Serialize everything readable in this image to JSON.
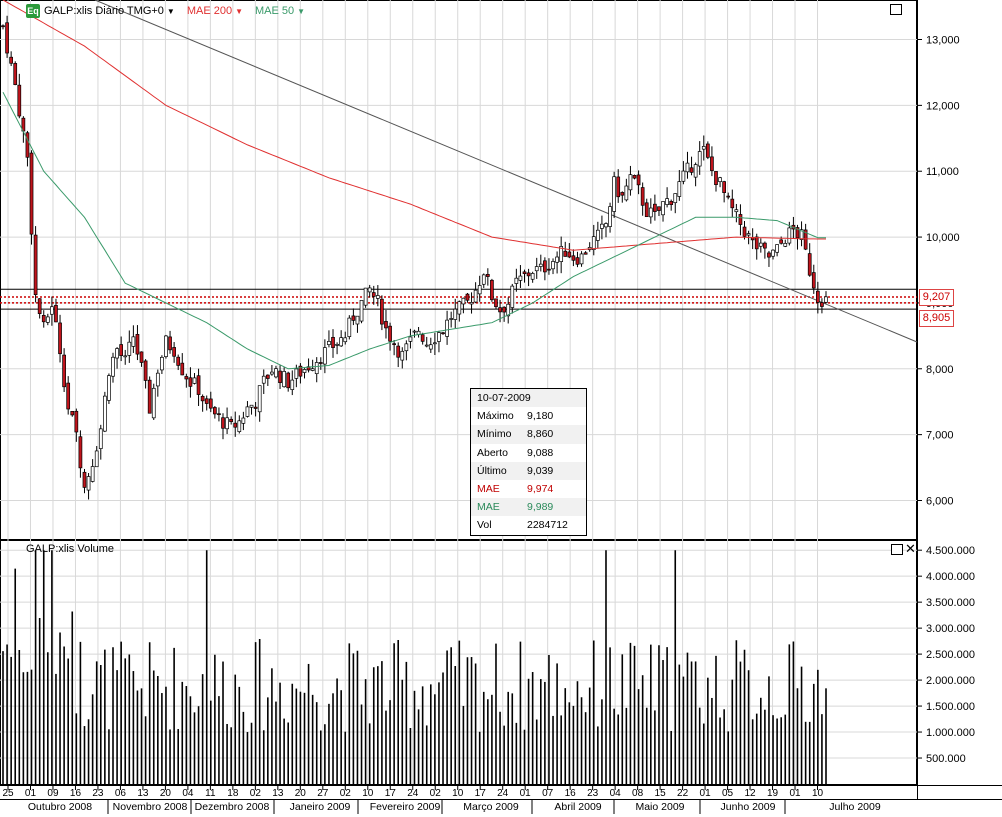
{
  "legend": {
    "badge": "Eq",
    "symbol": "GALP:xlis Diário TMG+0",
    "mae200": "MAE 200",
    "mae50": "MAE 50",
    "mae200_color": "#e03030",
    "mae50_color": "#3a9a6a"
  },
  "volume_panel": {
    "title": "GALP:xlis Volume"
  },
  "icons": {
    "maximize": "maximize-icon",
    "close": "close-icon"
  },
  "infobox": {
    "date": "10-07-2009",
    "rows": [
      {
        "label": "Máximo",
        "value": "9,180"
      },
      {
        "label": "Mínimo",
        "value": "8,860"
      },
      {
        "label": "Aberto",
        "value": "9,088"
      },
      {
        "label": "Último",
        "value": "9,039"
      },
      {
        "label": "MAE",
        "value": "9,974",
        "color": "#c00000"
      },
      {
        "label": "MAE",
        "value": "9,989",
        "color": "#2a8a5a"
      },
      {
        "label": "Vol",
        "value": "2284712"
      }
    ]
  },
  "price_tags": [
    "9,207",
    "8,905"
  ],
  "chart_data": {
    "type": "candlestick",
    "price_axis": {
      "ylim": [
        5.4,
        13.6
      ],
      "ticks": [
        13,
        12,
        11,
        10,
        9,
        8,
        7,
        6
      ],
      "tick_labels": [
        "13,000",
        "12,000",
        "11,000",
        "10,000",
        "9,000",
        "8,000",
        "7,000",
        "6,000"
      ]
    },
    "volume_axis": {
      "ylim": [
        0,
        4600000
      ],
      "ticks": [
        4500000,
        4000000,
        3500000,
        3000000,
        2500000,
        2000000,
        1500000,
        1000000,
        500000
      ],
      "tick_labels": [
        "4.500.000",
        "4.000.000",
        "3.500.000",
        "3.000.000",
        "2.500.000",
        "2.000.000",
        "1.500.000",
        "1.000.000",
        "500.000"
      ]
    },
    "x_day_labels": [
      "25",
      "01",
      "09",
      "16",
      "23",
      "06",
      "13",
      "20",
      "04",
      "11",
      "18",
      "02",
      "13",
      "20",
      "27",
      "02",
      "10",
      "17",
      "24",
      "02",
      "10",
      "17",
      "24",
      "01",
      "07",
      "16",
      "23",
      "04",
      "08",
      "15",
      "22",
      "01",
      "05",
      "12",
      "19",
      "01",
      "10"
    ],
    "x_month_labels": [
      "Outubro 2008",
      "Novembro 2008",
      "Dezembro 2008",
      "Janeiro 2009",
      "Fevereiro 2009",
      "Março 2009",
      "Abril 2009",
      "Maio 2009",
      "Junho 2009",
      "Julho 2009"
    ],
    "horizontal_levels": [
      9.207,
      8.905,
      9.2,
      8.9
    ],
    "trendline": {
      "from": [
        0,
        13.7
      ],
      "to": [
        210,
        8.5
      ]
    },
    "keypoints_close": [
      [
        0,
        13.2
      ],
      [
        3,
        12.3
      ],
      [
        6,
        11.2
      ],
      [
        8,
        9.1
      ],
      [
        10,
        8.6
      ],
      [
        12,
        9.0
      ],
      [
        14,
        8.3
      ],
      [
        16,
        7.4
      ],
      [
        18,
        7.0
      ],
      [
        20,
        6.2
      ],
      [
        22,
        6.6
      ],
      [
        24,
        7.1
      ],
      [
        26,
        8.0
      ],
      [
        28,
        8.3
      ],
      [
        30,
        8.1
      ],
      [
        32,
        8.5
      ],
      [
        34,
        8.0
      ],
      [
        36,
        7.4
      ],
      [
        38,
        8.0
      ],
      [
        40,
        8.4
      ],
      [
        42,
        8.3
      ],
      [
        44,
        8.0
      ],
      [
        46,
        7.8
      ],
      [
        48,
        7.7
      ],
      [
        50,
        7.4
      ],
      [
        52,
        7.3
      ],
      [
        54,
        7.2
      ],
      [
        56,
        7.1
      ],
      [
        58,
        7.2
      ],
      [
        60,
        7.4
      ],
      [
        62,
        7.5
      ],
      [
        64,
        7.8
      ],
      [
        66,
        8.0
      ],
      [
        68,
        7.9
      ],
      [
        70,
        7.8
      ],
      [
        72,
        7.9
      ],
      [
        74,
        8.0
      ],
      [
        76,
        8.1
      ],
      [
        78,
        8.2
      ],
      [
        80,
        8.3
      ],
      [
        82,
        8.4
      ],
      [
        84,
        8.5
      ],
      [
        86,
        8.8
      ],
      [
        88,
        9.0
      ],
      [
        90,
        9.2
      ],
      [
        92,
        9.0
      ],
      [
        94,
        8.6
      ],
      [
        96,
        8.4
      ],
      [
        98,
        8.2
      ],
      [
        100,
        8.4
      ],
      [
        102,
        8.6
      ],
      [
        104,
        8.4
      ],
      [
        106,
        8.5
      ],
      [
        108,
        8.6
      ],
      [
        110,
        8.8
      ],
      [
        112,
        8.9
      ],
      [
        114,
        9.0
      ],
      [
        116,
        9.2
      ],
      [
        118,
        9.5
      ],
      [
        120,
        9.1
      ],
      [
        122,
        8.9
      ],
      [
        124,
        9.0
      ],
      [
        126,
        9.3
      ],
      [
        128,
        9.4
      ],
      [
        130,
        9.5
      ],
      [
        132,
        9.5
      ],
      [
        134,
        9.6
      ],
      [
        136,
        9.7
      ],
      [
        138,
        9.8
      ],
      [
        140,
        9.7
      ],
      [
        142,
        9.7
      ],
      [
        144,
        9.9
      ],
      [
        146,
        10.0
      ],
      [
        148,
        10.2
      ],
      [
        150,
        10.8
      ],
      [
        152,
        10.6
      ],
      [
        154,
        10.9
      ],
      [
        156,
        10.7
      ],
      [
        158,
        10.4
      ],
      [
        160,
        10.3
      ],
      [
        162,
        10.5
      ],
      [
        164,
        10.6
      ],
      [
        166,
        10.8
      ],
      [
        168,
        11.0
      ],
      [
        170,
        11.2
      ],
      [
        172,
        11.3
      ],
      [
        174,
        11.0
      ],
      [
        176,
        10.8
      ],
      [
        178,
        10.5
      ],
      [
        180,
        10.3
      ],
      [
        182,
        10.1
      ],
      [
        184,
        9.9
      ],
      [
        186,
        9.8
      ],
      [
        188,
        9.7
      ],
      [
        190,
        9.8
      ],
      [
        192,
        10.0
      ],
      [
        194,
        10.1
      ],
      [
        196,
        10.0
      ],
      [
        198,
        9.5
      ],
      [
        200,
        9.1
      ],
      [
        202,
        9.04
      ]
    ],
    "mae200_points": [
      [
        0,
        13.6
      ],
      [
        20,
        12.9
      ],
      [
        40,
        12.0
      ],
      [
        60,
        11.4
      ],
      [
        80,
        10.9
      ],
      [
        100,
        10.5
      ],
      [
        120,
        10.0
      ],
      [
        140,
        9.8
      ],
      [
        160,
        9.9
      ],
      [
        180,
        10.0
      ],
      [
        200,
        9.97
      ]
    ],
    "mae50_points": [
      [
        0,
        12.2
      ],
      [
        10,
        11.0
      ],
      [
        20,
        10.3
      ],
      [
        30,
        9.3
      ],
      [
        40,
        9.0
      ],
      [
        50,
        8.7
      ],
      [
        60,
        8.3
      ],
      [
        70,
        8.0
      ],
      [
        80,
        8.05
      ],
      [
        90,
        8.3
      ],
      [
        100,
        8.5
      ],
      [
        110,
        8.6
      ],
      [
        120,
        8.7
      ],
      [
        130,
        9.0
      ],
      [
        140,
        9.4
      ],
      [
        150,
        9.7
      ],
      [
        160,
        10.0
      ],
      [
        170,
        10.3
      ],
      [
        180,
        10.3
      ],
      [
        190,
        10.25
      ],
      [
        200,
        9.99
      ]
    ],
    "n_bars": 203,
    "volume_scale": 4600000
  }
}
